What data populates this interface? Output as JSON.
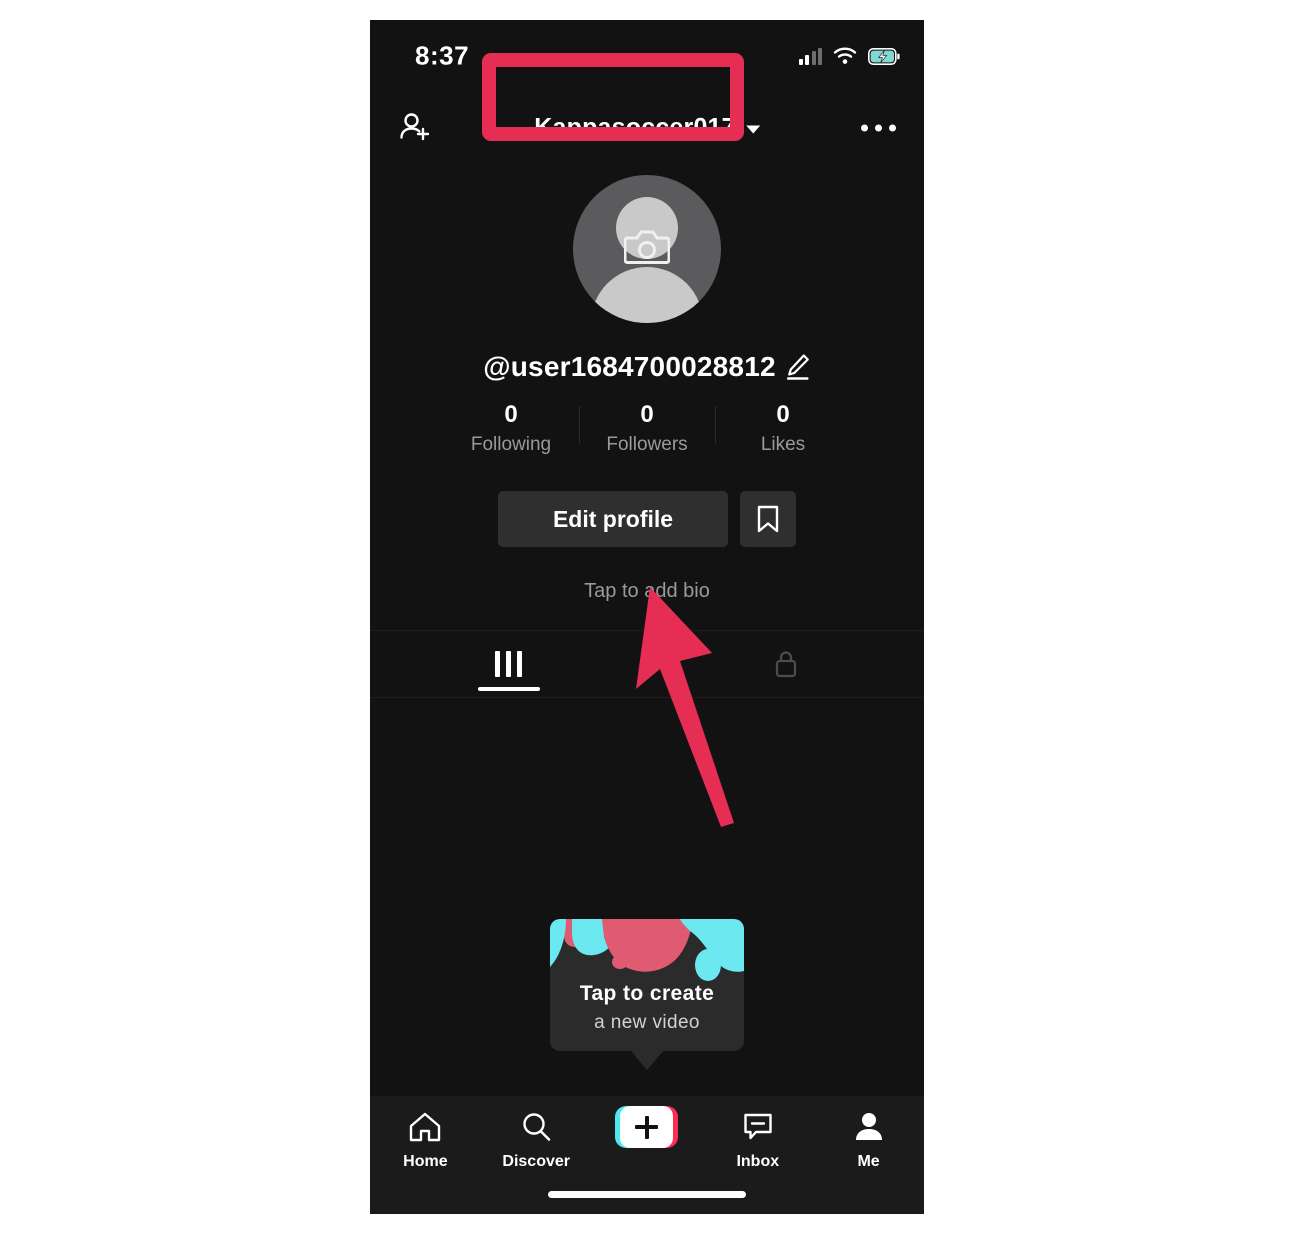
{
  "status_bar": {
    "time": "8:37",
    "icons": [
      "signal-bars-icon",
      "wifi-icon",
      "battery-charging-icon"
    ]
  },
  "header": {
    "add_person_icon": "add-person-icon",
    "title": "Kappasoccer017",
    "caret_icon": "chevron-down-icon",
    "more_icon": "more-options-icon"
  },
  "profile": {
    "avatar_icon": "camera-icon",
    "avatar_placeholder": "default-person-avatar",
    "username": "@user1684700028812",
    "edit_username_icon": "pencil-edit-icon",
    "stats": [
      {
        "value": "0",
        "label": "Following"
      },
      {
        "value": "0",
        "label": "Followers"
      },
      {
        "value": "0",
        "label": "Likes"
      }
    ],
    "edit_profile_label": "Edit profile",
    "bookmark_icon": "bookmark-icon",
    "bio_placeholder": "Tap to add bio"
  },
  "tabs": [
    {
      "icon": "grid-posts-icon",
      "active": true
    },
    {
      "icon": "lock-private-icon",
      "active": false
    }
  ],
  "create_tooltip": {
    "line1": "Tap to create",
    "line2": "a new video"
  },
  "bottom_nav": [
    {
      "label": "Home",
      "icon": "home-icon"
    },
    {
      "label": "Discover",
      "icon": "search-icon"
    },
    {
      "label": "",
      "icon": "create-plus-icon"
    },
    {
      "label": "Inbox",
      "icon": "inbox-message-icon"
    },
    {
      "label": "Me",
      "icon": "person-icon"
    }
  ],
  "annotations": {
    "highlight_color": "#e62e55",
    "arrow_color": "#e62e55",
    "arrow_target": "edit-profile-button"
  },
  "colors": {
    "screen_bg": "#121212",
    "nav_bg": "#1b1b1b",
    "button_bg": "#2f2f2f",
    "tiktok_cyan": "#4de8f0",
    "tiktok_pink": "#fe2c55",
    "muted_text": "#9a9a9a"
  }
}
